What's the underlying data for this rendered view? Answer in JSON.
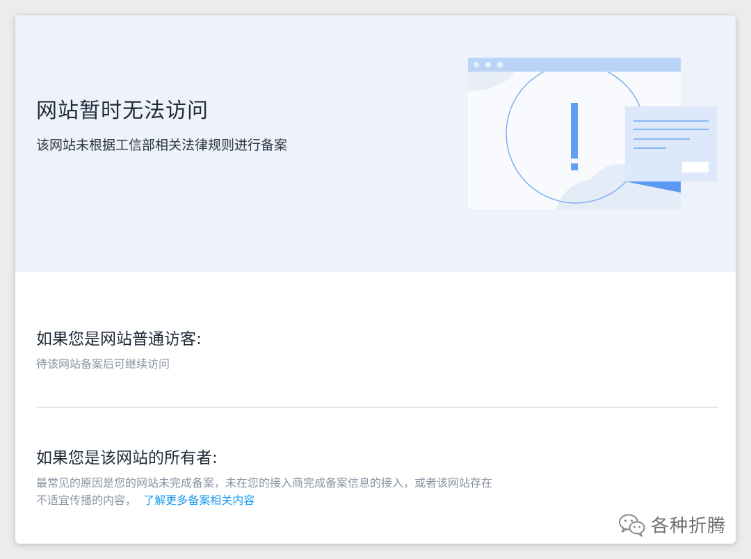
{
  "hero": {
    "title": "网站暂时无法访问",
    "subtitle": "该网站未根据工信部相关法律规则进行备案"
  },
  "visitor": {
    "heading": "如果您是网站普通访客:",
    "text": "待该网站备案后可继续访问"
  },
  "owner": {
    "heading": "如果您是该网站的所有者:",
    "text_line1": "最常见的原因是您的网站未完成备案，未在您的接入商完成备案信息的接入，或者该网站存在",
    "text_line2": "不适宜传播的内容，",
    "link": "了解更多备案相关内容"
  },
  "watermark": {
    "text": "各种折腾",
    "icon": "wechat-icon"
  },
  "colors": {
    "hero_background": "#eef3fb",
    "accent_blue": "#4f93f5",
    "link_blue": "#1d9bf0",
    "muted_text": "#8a93a3"
  }
}
